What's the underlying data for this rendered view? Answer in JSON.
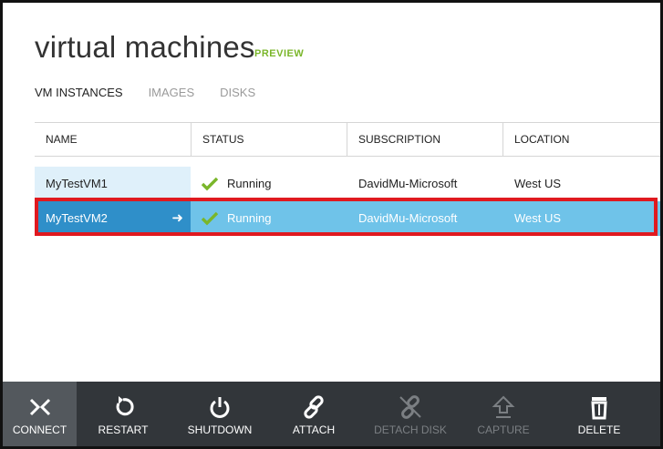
{
  "header": {
    "title": "virtual machines",
    "badge": "PREVIEW"
  },
  "tabs": [
    {
      "label": "VM INSTANCES",
      "active": true
    },
    {
      "label": "IMAGES",
      "active": false
    },
    {
      "label": "DISKS",
      "active": false
    }
  ],
  "table": {
    "columns": [
      "NAME",
      "STATUS",
      "SUBSCRIPTION",
      "LOCATION"
    ],
    "rows": [
      {
        "name": "MyTestVM1",
        "status": "Running",
        "subscription": "DavidMu-Microsoft",
        "location": "West US",
        "selected": false
      },
      {
        "name": "MyTestVM2",
        "status": "Running",
        "subscription": "DavidMu-Microsoft",
        "location": "West US",
        "selected": true
      }
    ]
  },
  "commands": [
    {
      "label": "CONNECT",
      "icon": "connect-icon",
      "enabled": true,
      "selected": true
    },
    {
      "label": "RESTART",
      "icon": "restart-icon",
      "enabled": true
    },
    {
      "label": "SHUTDOWN",
      "icon": "power-icon",
      "enabled": true
    },
    {
      "label": "ATTACH",
      "icon": "link-icon",
      "enabled": true
    },
    {
      "label": "DETACH DISK",
      "icon": "broken-link-icon",
      "enabled": false
    },
    {
      "label": "CAPTURE",
      "icon": "upload-icon",
      "enabled": false
    },
    {
      "label": "DELETE",
      "icon": "trash-icon",
      "enabled": true
    }
  ],
  "colors": {
    "accent_green": "#7ab62a",
    "selected_row": "#6fc3e9",
    "selected_name": "#2f8fc9",
    "highlight_border": "#e0191f",
    "command_bar": "#32363a"
  }
}
